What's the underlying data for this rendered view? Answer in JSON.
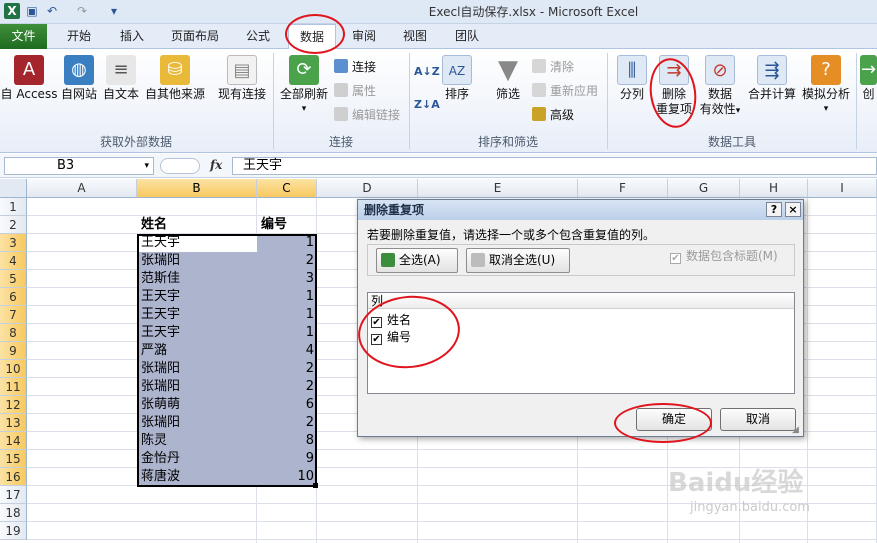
{
  "window": {
    "title": "Execl自动保存.xlsx  -  Microsoft Excel",
    "qat": [
      "excel-logo-icon",
      "save-icon",
      "undo-icon",
      "redo-icon",
      "customize-qat-icon"
    ]
  },
  "tabs": [
    "文件",
    "开始",
    "插入",
    "页面布局",
    "公式",
    "数据",
    "审阅",
    "视图",
    "团队"
  ],
  "active_tab": "数据",
  "ribbon": {
    "groups": {
      "external": "获取外部数据",
      "connections": "连接",
      "sort_filter": "排序和筛选",
      "data_tools": "数据工具"
    },
    "buttons": {
      "access": "自 Access",
      "web": "自网站",
      "text": "自文本",
      "other": "自其他来源",
      "existing": "现有连接",
      "refresh_all": "全部刷新",
      "connections": "连接",
      "properties": "属性",
      "edit_links": "编辑链接",
      "sort": "排序",
      "filter": "筛选",
      "clear": "清除",
      "reapply": "重新应用",
      "advanced": "高级",
      "text_to_columns": "分列",
      "remove_dup_1": "删除",
      "remove_dup_2": "重复项",
      "validation_1": "数据",
      "validation_2": "有效性",
      "consolidate": "合并计算",
      "whatif": "模拟分析",
      "create": "创"
    },
    "sort_az": "A↓Z",
    "sort_za": "Z↓A"
  },
  "formula_bar": {
    "name_box": "B3",
    "fx": "fx",
    "formula": "王天宇"
  },
  "sheet": {
    "columns": [
      "A",
      "B",
      "C",
      "D",
      "E",
      "F",
      "G",
      "H",
      "I"
    ],
    "rows": [
      "1",
      "2",
      "3",
      "4",
      "5",
      "6",
      "7",
      "8",
      "9",
      "10",
      "11",
      "12",
      "13",
      "14",
      "15",
      "16",
      "17",
      "18",
      "19"
    ],
    "headers": {
      "name": "姓名",
      "number": "编号"
    },
    "data": [
      {
        "name": "王天宇",
        "number": "1"
      },
      {
        "name": "张瑞阳",
        "number": "2"
      },
      {
        "name": "范斯佳",
        "number": "3"
      },
      {
        "name": "王天宇",
        "number": "1"
      },
      {
        "name": "王天宇",
        "number": "1"
      },
      {
        "name": "王天宇",
        "number": "1"
      },
      {
        "name": "严潞",
        "number": "4"
      },
      {
        "name": "张瑞阳",
        "number": "2"
      },
      {
        "name": "张瑞阳",
        "number": "2"
      },
      {
        "name": "张萌萌",
        "number": "6"
      },
      {
        "name": "张瑞阳",
        "number": "2"
      },
      {
        "name": "陈灵",
        "number": "8"
      },
      {
        "name": "金怡丹",
        "number": "9"
      },
      {
        "name": "蒋唐波",
        "number": "10"
      }
    ]
  },
  "dialog": {
    "title": "删除重复项",
    "help_btn": "?",
    "close_btn": "×",
    "message": "若要删除重复值，请选择一个或多个包含重复值的列。",
    "select_all": "全选(A)",
    "unselect_all": "取消全选(U)",
    "has_headers": "数据包含标题(M)",
    "list_header": "列",
    "columns": [
      {
        "label": "姓名",
        "checked": "✔"
      },
      {
        "label": "编号",
        "checked": "✔"
      }
    ],
    "ok": "确定",
    "cancel": "取消"
  },
  "watermark": {
    "main": "Baidu经验",
    "sub": "jingyan.baidu.com"
  },
  "colors": {
    "selection_fill": "#adb4cd",
    "file_tab": "#2e7d32",
    "annotation": "#e0141c"
  }
}
